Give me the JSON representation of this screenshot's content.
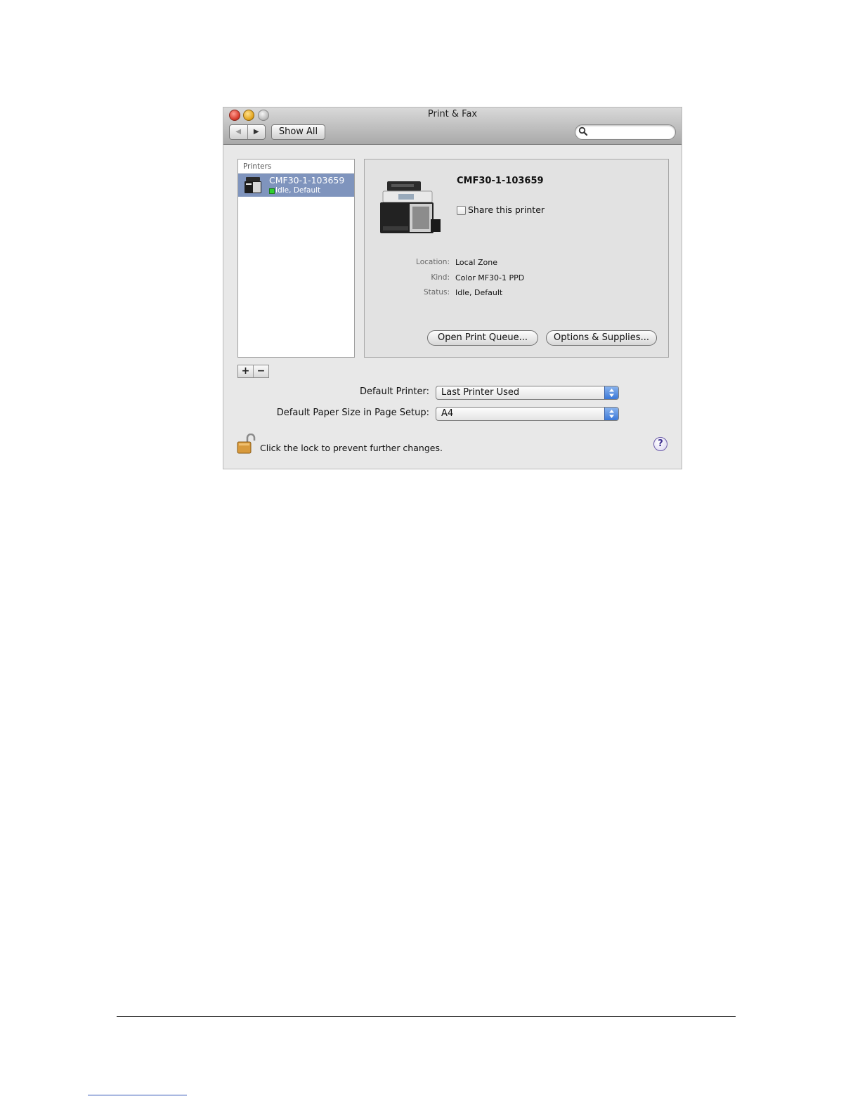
{
  "window": {
    "title": "Print & Fax"
  },
  "toolbar": {
    "back_glyph": "◀",
    "forward_glyph": "▶",
    "show_all_label": "Show All",
    "search_placeholder": ""
  },
  "printers_list": {
    "header": "Printers",
    "items": [
      {
        "name": "CMF30-1-103659",
        "status": "Idle, Default",
        "status_color": "#2fcf2f"
      }
    ]
  },
  "detail": {
    "printer_name": "CMF30-1-103659",
    "share_label": "Share this printer",
    "share_checked": false,
    "location_label": "Location:",
    "location_value": "Local Zone",
    "kind_label": "Kind:",
    "kind_value": "Color MF30-1 PPD",
    "status_label": "Status:",
    "status_value": "Idle, Default",
    "open_queue_label": "Open Print Queue...",
    "options_label": "Options & Supplies..."
  },
  "list_controls": {
    "add_glyph": "+",
    "remove_glyph": "−"
  },
  "defaults": {
    "default_printer_label": "Default Printer:",
    "default_printer_value": "Last Printer Used",
    "paper_size_label": "Default Paper Size in Page Setup:",
    "paper_size_value": "A4"
  },
  "lock": {
    "text": "Click the lock to prevent further changes."
  },
  "help": {
    "glyph": "?"
  },
  "colors": {
    "selection": "#7f94bd",
    "accent_popup": "#3b78d8"
  },
  "icons": [
    "search-icon",
    "printer-icon",
    "lock-icon",
    "help-icon"
  ]
}
